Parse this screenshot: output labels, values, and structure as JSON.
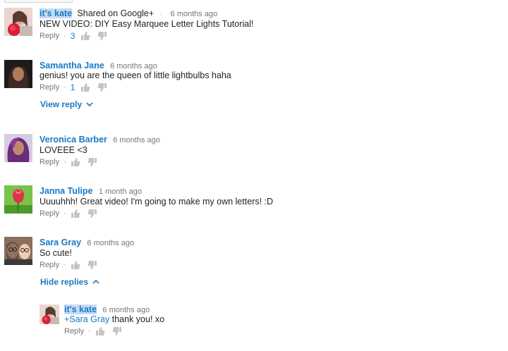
{
  "comments": [
    {
      "author": "it's kate",
      "shared": "Shared on Google+",
      "dot": "·",
      "time": "6 months ago",
      "text": "NEW VIDEO: DIY Easy Marquee Letter Lights Tutorial!",
      "reply": "Reply",
      "likes": "3"
    },
    {
      "author": "Samantha Jane",
      "time": "6 months ago",
      "text": "genius! you are the queen of little lightbulbs haha",
      "reply": "Reply",
      "likes": "1",
      "toggle": "View reply"
    },
    {
      "author": "Veronica Barber",
      "time": "6 months ago",
      "text": "LOVEEE <3",
      "reply": "Reply"
    },
    {
      "author": "Janna Tulipe",
      "time": "1 month ago",
      "text": "Uuuuhhh! Great video! I'm going to make my own letters! :D",
      "reply": "Reply"
    },
    {
      "author": "Sara Gray",
      "time": "6 months ago",
      "text": "So cute!",
      "reply": "Reply",
      "toggle": "Hide replies"
    }
  ],
  "reply": {
    "author": "it's kate",
    "time": "6 months ago",
    "mention": "+Sara Gray",
    "text": " thank you! xo",
    "reply": "Reply"
  },
  "action_dot": "·",
  "icons": {
    "like": "thumbs-up-icon",
    "dislike": "thumbs-down-icon",
    "expand": "chevron-down-icon",
    "collapse": "chevron-up-icon"
  },
  "colors": {
    "link": "#167ac6",
    "highlight": "#c6dbf3",
    "muted": "#767676",
    "icon": "#c4c4c4"
  }
}
